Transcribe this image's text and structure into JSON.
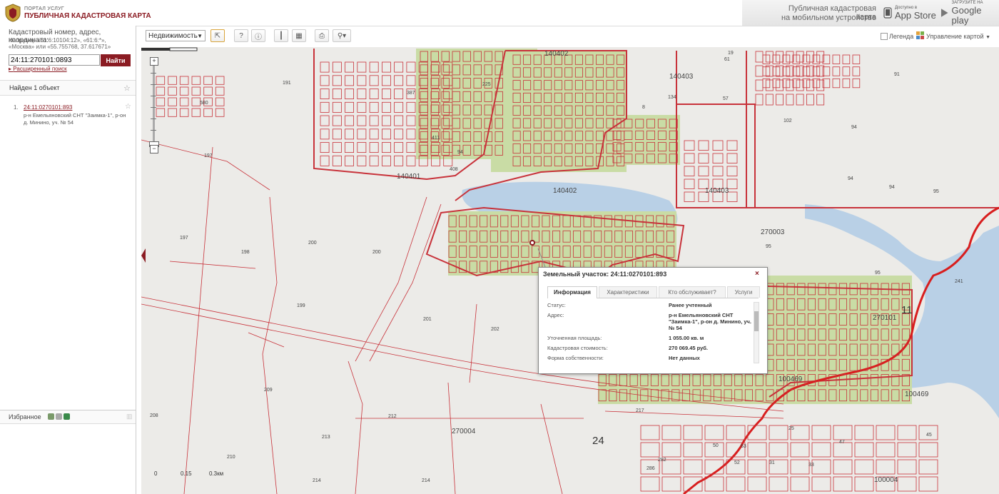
{
  "header": {
    "portal_sub": "ПОРТАЛ УСЛУГ",
    "portal_title": "ПУБЛИЧНАЯ КАДАСТРОВАЯ КАРТА",
    "mobile_line1": "Публичная кадастровая карта",
    "mobile_line2": "на мобильном устройстве",
    "appstore_small": "Доступно в",
    "appstore_big": "App Store",
    "googleplay_small": "ЗАГРУЗИТЕ НА",
    "googleplay_big": "Google play"
  },
  "search": {
    "label": "Кадастровый номер, адрес, координата:",
    "example1": "Например «61:6:10104:12», «61:6:*»,",
    "example2": "«Москва» или «55.755768, 37.617671»",
    "value": "24:11:270101:0893",
    "find_label": "Найти",
    "advanced_label": "Расширенный поиск"
  },
  "results": {
    "title": "Найден 1 объект",
    "items": [
      {
        "num": "1.",
        "link": "24:11:0270101:893",
        "address": "р-н Емельяновский СНТ \"Заимка-1\", р-он д. Минино, уч. № 54"
      }
    ]
  },
  "favorites": {
    "label": "Избранное"
  },
  "toolbar": {
    "type_select": "Недвижимость",
    "legend_label": "Легенда",
    "map_control_label": "Управление картой"
  },
  "map": {
    "zoom_plus": "+",
    "zoom_minus": "−",
    "scale_labels": [
      "0",
      "0.15",
      "0.3км"
    ],
    "labels": [
      {
        "t": "140402",
        "s": "mid"
      },
      {
        "t": "140403",
        "s": "mid"
      },
      {
        "t": "140401",
        "s": "mid"
      },
      {
        "t": "140402",
        "s": "mid"
      },
      {
        "t": "140403",
        "s": "mid"
      },
      {
        "t": "270003",
        "s": "mid"
      },
      {
        "t": "270101",
        "s": "mid"
      },
      {
        "t": "100469",
        "s": "mid"
      },
      {
        "t": "100469",
        "s": "mid"
      },
      {
        "t": "270004",
        "s": "mid"
      },
      {
        "t": "100004",
        "s": "mid"
      },
      {
        "t": "24",
        "s": "big"
      },
      {
        "t": "11",
        "s": "big"
      },
      {
        "t": "191",
        "s": "s"
      },
      {
        "t": "197",
        "s": "s"
      },
      {
        "t": "197",
        "s": "s"
      },
      {
        "t": "198",
        "s": "s"
      },
      {
        "t": "200",
        "s": "s"
      },
      {
        "t": "200",
        "s": "s"
      },
      {
        "t": "199",
        "s": "s"
      },
      {
        "t": "201",
        "s": "s"
      },
      {
        "t": "202",
        "s": "s"
      },
      {
        "t": "209",
        "s": "s"
      },
      {
        "t": "208",
        "s": "s"
      },
      {
        "t": "210",
        "s": "s"
      },
      {
        "t": "212",
        "s": "s"
      },
      {
        "t": "213",
        "s": "s"
      },
      {
        "t": "214",
        "s": "s"
      },
      {
        "t": "214",
        "s": "s"
      },
      {
        "t": "217",
        "s": "s"
      },
      {
        "t": "61",
        "s": "s"
      },
      {
        "t": "57",
        "s": "s"
      },
      {
        "t": "102",
        "s": "s"
      },
      {
        "t": "94",
        "s": "s"
      },
      {
        "t": "91",
        "s": "s"
      },
      {
        "t": "94",
        "s": "s"
      },
      {
        "t": "94",
        "s": "s"
      },
      {
        "t": "95",
        "s": "s"
      },
      {
        "t": "95",
        "s": "s"
      },
      {
        "t": "95",
        "s": "s"
      },
      {
        "t": "241",
        "s": "s"
      },
      {
        "t": "580",
        "s": "s"
      },
      {
        "t": "225",
        "s": "s"
      },
      {
        "t": "411",
        "s": "s"
      },
      {
        "t": "94",
        "s": "s"
      },
      {
        "t": "408",
        "s": "s"
      },
      {
        "t": "387",
        "s": "s"
      },
      {
        "t": "8",
        "s": "s"
      },
      {
        "t": "19",
        "s": "s"
      },
      {
        "t": "134",
        "s": "s"
      },
      {
        "t": "50",
        "s": "s"
      },
      {
        "t": "63",
        "s": "s"
      },
      {
        "t": "52",
        "s": "s"
      },
      {
        "t": "31",
        "s": "s"
      },
      {
        "t": "33",
        "s": "s"
      },
      {
        "t": "282",
        "s": "s"
      },
      {
        "t": "286",
        "s": "s"
      },
      {
        "t": "25",
        "s": "s"
      },
      {
        "t": "47",
        "s": "s"
      },
      {
        "t": "45",
        "s": "s"
      }
    ]
  },
  "popup": {
    "title": "Земельный участок: 24:11:0270101:893",
    "close": "×",
    "tabs": [
      "Информация",
      "Характеристики",
      "Кто обслуживает?",
      "Услуги"
    ],
    "rows": [
      {
        "k": "Статус:",
        "v": "Ранее учтенный"
      },
      {
        "k": "Адрес:",
        "v": "р-н Емельяновский СНТ \"Заимка-1\", р-он д. Минино, уч. № 54"
      },
      {
        "k": "Уточненная площадь:",
        "v": "1 055.00 кв. м"
      },
      {
        "k": "Кадастровая стоимость:",
        "v": "270 069.45 руб."
      },
      {
        "k": "Форма собственности:",
        "v": "Нет данных"
      }
    ]
  },
  "colors": {
    "brand": "#8b1c23",
    "parcel_line": "#c8323a",
    "green_area": "#c9dca5",
    "water": "#b9d0e6",
    "map_bg": "#ecebe8"
  }
}
